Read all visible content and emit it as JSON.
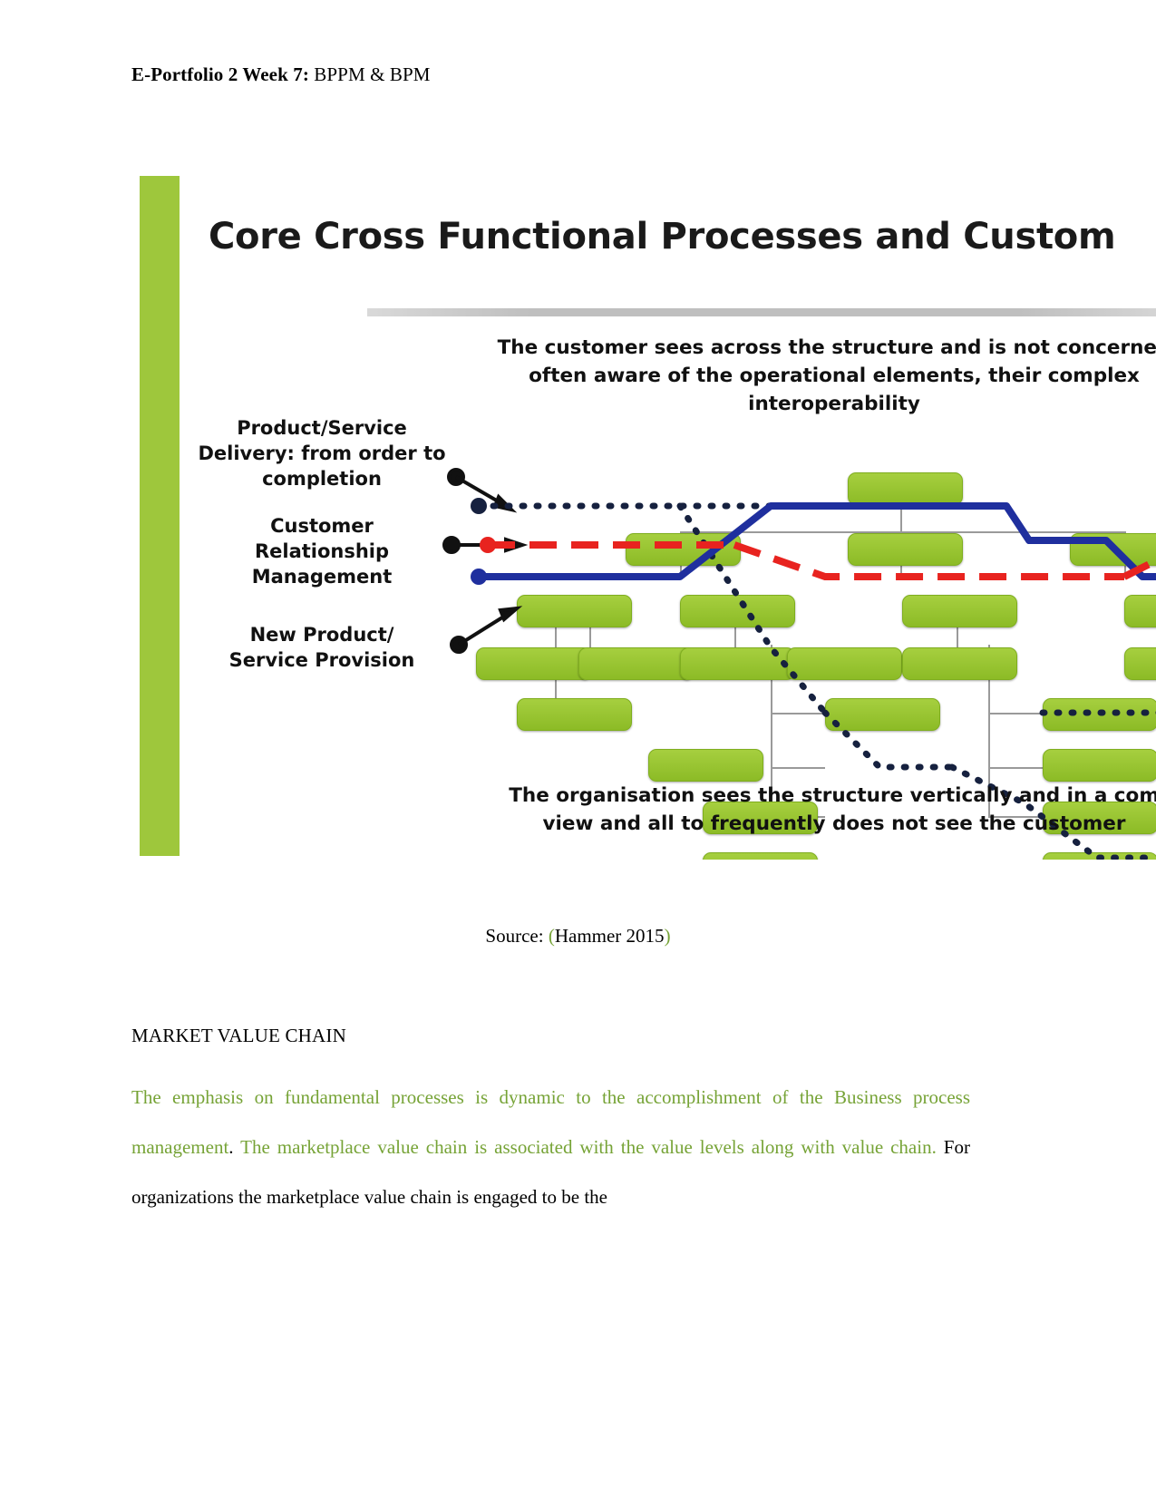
{
  "document": {
    "header_bold": "E-Portfolio 2 Week 7:",
    "header_rest": " BPPM & BPM"
  },
  "slide": {
    "title": "Core Cross Functional Processes and Custom",
    "top_caption_line1": "The customer sees across the structure and is not concerned",
    "top_caption_line2": "often aware of the operational elements, their complex",
    "top_caption_line3": "interoperability",
    "bottom_caption_line1": "The organisation sees the structure vertically and in a com",
    "bottom_caption_line2": "view and all to frequently does not see the customer",
    "labels": [
      "Product/Service Delivery: from order to completion",
      "Customer Relationship Management",
      "New Product/ Service Provision"
    ],
    "colors": {
      "accent_bar": "#9ec73c",
      "box_fill": "#8cbb26",
      "flow_blue": "#1f2f9e",
      "flow_red": "#e8231f",
      "flow_dotted": "#16213f"
    }
  },
  "caption": {
    "source_label": "Source: ",
    "open_paren": "(",
    "citation": "Hammer 2015",
    "close_paren": ")"
  },
  "body": {
    "section_title": "MARKET VALUE CHAIN",
    "green_part_1": "The emphasis on fundamental processes is dynamic to the accomplishment of the Business process management",
    "black_period": ".",
    "green_part_2": " The marketplace value chain is associated with the value levels along with value chain.",
    "black_part": " For organizations the marketplace value chain is engaged to be the"
  }
}
